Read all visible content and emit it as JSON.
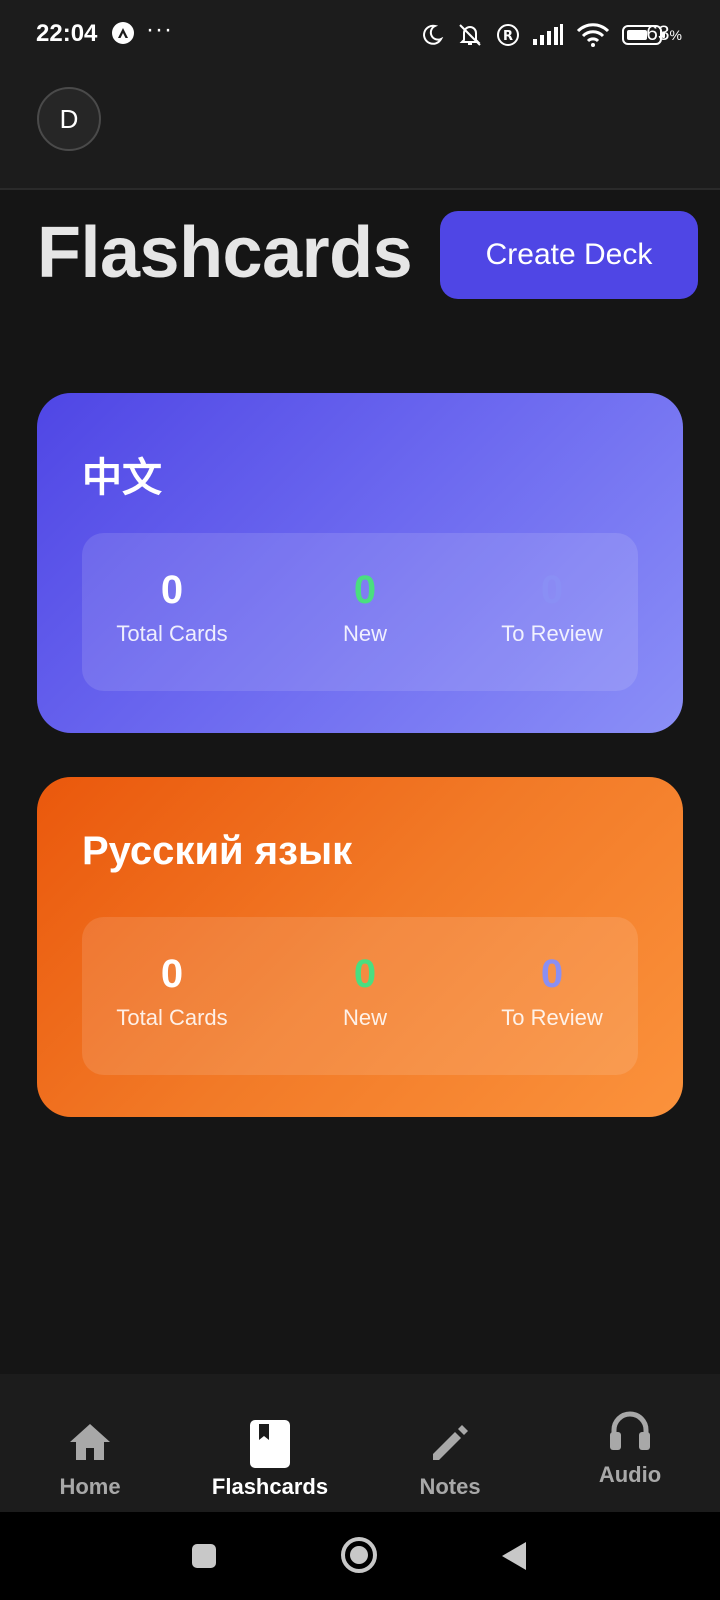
{
  "status_bar": {
    "time": "22:04",
    "more": "···",
    "battery_percent": "63",
    "percent_sign": "%",
    "icons": [
      "app-a-icon",
      "moon-icon",
      "bell-off-icon",
      "registered-icon",
      "signal-icon",
      "wifi-icon",
      "battery-icon"
    ]
  },
  "header": {
    "avatar_initial": "D"
  },
  "page": {
    "title": "Flashcards",
    "create_label": "Create Deck"
  },
  "decks": [
    {
      "title": "中文",
      "stats": [
        {
          "value": "0",
          "label": "Total Cards"
        },
        {
          "value": "0",
          "label": "New"
        },
        {
          "value": "0",
          "label": "To Review"
        }
      ]
    },
    {
      "title": "Русский язык",
      "stats": [
        {
          "value": "0",
          "label": "Total Cards"
        },
        {
          "value": "0",
          "label": "New"
        },
        {
          "value": "0",
          "label": "To Review"
        }
      ]
    }
  ],
  "nav": {
    "items": [
      {
        "label": "Home",
        "icon": "home-icon"
      },
      {
        "label": "Flashcards",
        "icon": "flashcards-icon"
      },
      {
        "label": "Notes",
        "icon": "pencil-icon"
      },
      {
        "label": "Audio",
        "icon": "headphones-icon"
      }
    ],
    "active": "Flashcards"
  },
  "system_nav": {
    "icons": [
      "recents-icon",
      "home-circle-icon",
      "back-icon"
    ]
  },
  "colors": {
    "accent": "#4f46e5",
    "deck_zh": "#6366f1",
    "deck_ru": "#f97316",
    "new_green": "#4ade80",
    "background": "#151515"
  }
}
